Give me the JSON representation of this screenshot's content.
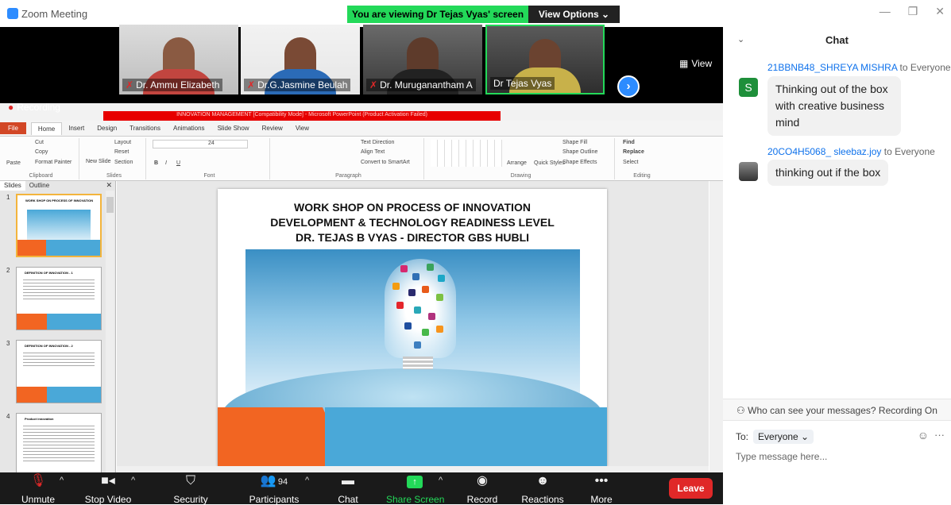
{
  "window": {
    "title": "Zoom Meeting",
    "banner": "You are viewing Dr Tejas Vyas' screen",
    "view_options": "View Options ⌄"
  },
  "gallery": {
    "participants": [
      {
        "name": "Dr. Ammu Elizabeth",
        "muted": true
      },
      {
        "name": "Dr.G.Jasmine Beulah",
        "muted": true
      },
      {
        "name": "Dr. Muruganantham A",
        "muted": true
      },
      {
        "name": "Dr Tejas Vyas",
        "muted": false
      }
    ],
    "view_label": "View"
  },
  "ppt": {
    "recording": "Recording",
    "title": "INNOVATION MANAGEMENT [Compatibility Mode] - Microsoft PowerPoint (Product Activation Failed)",
    "tabs": [
      "File",
      "Home",
      "Insert",
      "Design",
      "Transitions",
      "Animations",
      "Slide Show",
      "Review",
      "View"
    ],
    "ribbon": {
      "clipboard": {
        "label": "Clipboard",
        "paste": "Paste",
        "cut": "Cut",
        "copy": "Copy",
        "format_painter": "Format Painter"
      },
      "slides": {
        "label": "Slides",
        "new_slide": "New Slide",
        "layout": "Layout",
        "reset": "Reset",
        "section": "Section"
      },
      "font": {
        "label": "Font",
        "size": "24"
      },
      "paragraph": {
        "label": "Paragraph",
        "text_direction": "Text Direction",
        "align_text": "Align Text",
        "smartart": "Convert to SmartArt"
      },
      "drawing": {
        "label": "Drawing",
        "arrange": "Arrange",
        "quick_styles": "Quick Styles",
        "shape_fill": "Shape Fill",
        "shape_outline": "Shape Outline",
        "shape_effects": "Shape Effects"
      },
      "editing": {
        "label": "Editing",
        "find": "Find",
        "replace": "Replace",
        "select": "Select"
      }
    },
    "sidebar": {
      "tab_slides": "Slides",
      "tab_outline": "Outline",
      "thumbs": [
        {
          "num": "1",
          "title": "WORK SHOP ON PROCESS OF INNOVATION"
        },
        {
          "num": "2",
          "title": "DEFINITION OF INNOVATION - 1"
        },
        {
          "num": "3",
          "title": "DEFINITION OF INNOVATION - 2"
        },
        {
          "num": "4",
          "title": "Product innovation"
        }
      ]
    },
    "slide": {
      "line1": "WORK SHOP ON PROCESS OF INNOVATION",
      "line2": "DEVELOPMENT & TECHNOLOGY READINESS LEVEL",
      "line3": "DR. TEJAS B VYAS - DIRECTOR GBS HUBLI"
    }
  },
  "controls": {
    "unmute": "Unmute",
    "stop_video": "Stop Video",
    "security": "Security",
    "participants": "Participants",
    "participants_count": "94",
    "chat": "Chat",
    "share_screen": "Share Screen",
    "record": "Record",
    "reactions": "Reactions",
    "more": "More",
    "leave": "Leave"
  },
  "chat": {
    "title": "Chat",
    "messages": [
      {
        "sender": "21BBNB48_SHREYA MISHRA",
        "to": "to Everyone",
        "avatar": "S",
        "text": "Thinking out of the box with creative business mind"
      },
      {
        "sender": "20CO4H5068_ sleebaz.joy",
        "to": "to Everyone",
        "text": "thinking out if the box"
      }
    ],
    "privacy": "Who can see your messages? Recording On",
    "to_label": "To:",
    "to_value": "Everyone ⌄",
    "placeholder": "Type message here..."
  }
}
